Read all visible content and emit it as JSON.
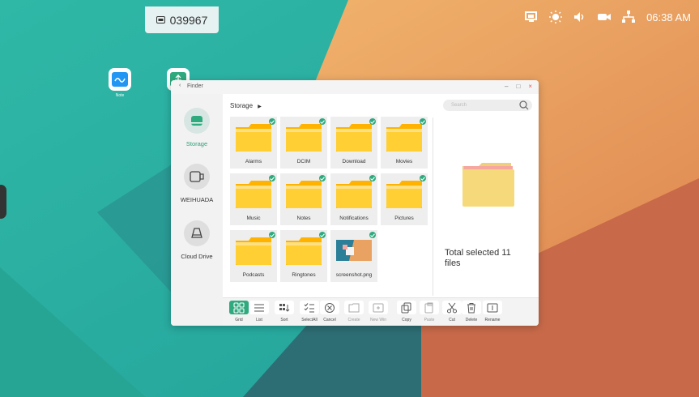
{
  "topbar": {
    "code": "039967",
    "icon": "screen-share-icon"
  },
  "status_bar": {
    "time": "06:38 AM",
    "icons": [
      "screen-cast-icon",
      "brightness-icon",
      "volume-icon",
      "camera-icon",
      "network-icon"
    ]
  },
  "desktop_icons": [
    {
      "label": "Note",
      "icon": "note-app-icon"
    },
    {
      "label": "",
      "icon": "usb-app-icon"
    }
  ],
  "window": {
    "title": "Finder",
    "controls": {
      "minimize": "–",
      "maximize": "□",
      "close": "×"
    },
    "sidebar": [
      {
        "label": "Storage",
        "icon": "storage-icon",
        "active": true
      },
      {
        "label": "WEIHUADA",
        "icon": "usb-drive-icon",
        "active": false
      },
      {
        "label": "Cloud Drive",
        "icon": "cloud-drive-icon",
        "active": false
      }
    ],
    "path": "Storage",
    "search_placeholder": "Search",
    "files": [
      {
        "name": "Alarms",
        "type": "folder"
      },
      {
        "name": "DCIM",
        "type": "folder"
      },
      {
        "name": "Download",
        "type": "folder"
      },
      {
        "name": "Movies",
        "type": "folder"
      },
      {
        "name": "Music",
        "type": "folder"
      },
      {
        "name": "Notes",
        "type": "folder"
      },
      {
        "name": "Notifications",
        "type": "folder"
      },
      {
        "name": "Pictures",
        "type": "folder"
      },
      {
        "name": "Podcasts",
        "type": "folder"
      },
      {
        "name": "Ringtones",
        "type": "folder"
      },
      {
        "name": "screenshot.png",
        "type": "image"
      }
    ],
    "selection_text": "Total selected 11 files",
    "toolbar": [
      {
        "label": "Grid",
        "icon": "grid-icon",
        "active": true
      },
      {
        "label": "List",
        "icon": "list-icon"
      },
      {
        "label": "Sort",
        "icon": "sort-icon"
      },
      {
        "label": "SelectAll",
        "icon": "select-all-icon"
      },
      {
        "label": "Cancel",
        "icon": "cancel-icon"
      },
      {
        "label": "Create",
        "icon": "new-folder-icon",
        "disabled": true
      },
      {
        "label": "New Win",
        "icon": "new-window-icon",
        "disabled": true
      },
      {
        "label": "Copy",
        "icon": "copy-icon"
      },
      {
        "label": "Paste",
        "icon": "paste-icon",
        "disabled": true
      },
      {
        "label": "Cut",
        "icon": "cut-icon"
      },
      {
        "label": "Delete",
        "icon": "delete-icon"
      },
      {
        "label": "Rename",
        "icon": "rename-icon"
      }
    ]
  },
  "colors": {
    "accent": "#2faa7f",
    "folder": "#ffc107",
    "teal_wall": "#2aa79b",
    "orange_wall": "#e9a262"
  }
}
